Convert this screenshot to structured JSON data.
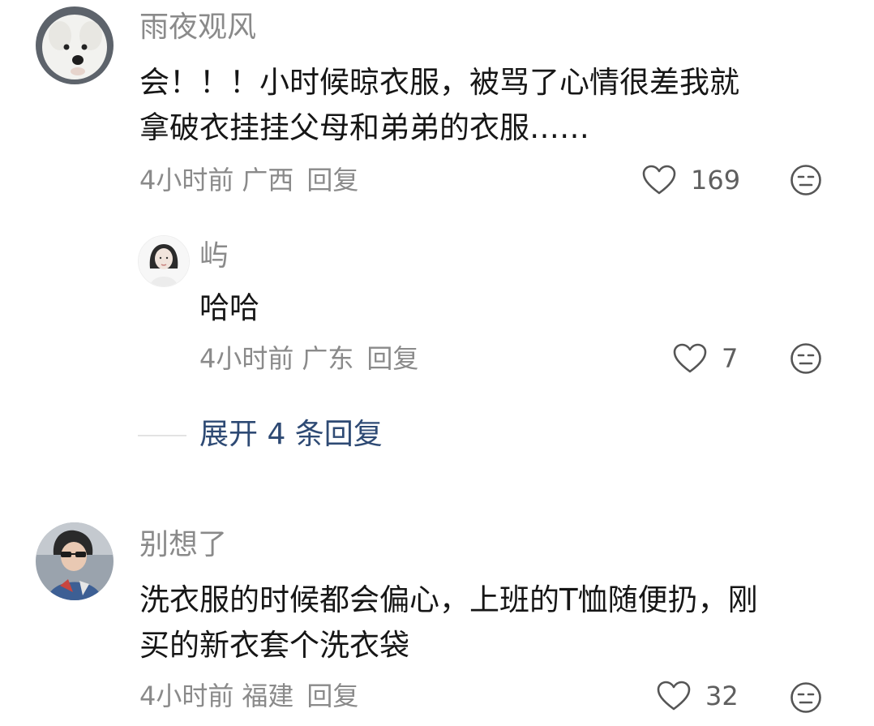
{
  "comments": [
    {
      "username": "雨夜观风",
      "text": "会！！！小时候晾衣服，被骂了心情很差我就\n拿破衣挂挂父母和弟弟的衣服……",
      "time": "4小时前",
      "location": "广西",
      "reply_label": "回复",
      "likes": "169",
      "avatar_icon": "white-dog-avatar"
    },
    {
      "username": "屿",
      "text": "哈哈",
      "time": "4小时前",
      "location": "广东",
      "reply_label": "回复",
      "likes": "7",
      "avatar_icon": "woman-portrait-avatar"
    },
    {
      "username": "别想了",
      "text": "洗衣服的时候都会偏心，上班的T恤随便扔，刚\n买的新衣套个洗衣袋",
      "time": "4小时前",
      "location": "福建",
      "reply_label": "回复",
      "likes": "32",
      "avatar_icon": "man-sunglasses-avatar"
    }
  ],
  "expand": {
    "label": "展开 4 条回复"
  },
  "icons": {
    "like": "heart-outline-icon",
    "reaction": "neutral-face-icon"
  },
  "colors": {
    "username": "#8a8a8a",
    "link": "#2e4a74",
    "text": "#161616"
  }
}
